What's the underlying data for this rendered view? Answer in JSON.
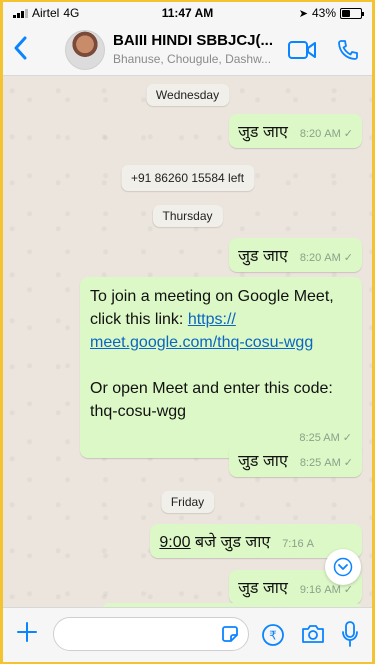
{
  "status_bar": {
    "carrier": "Airtel",
    "network": "4G",
    "time": "11:47 AM",
    "battery": "43%",
    "battery_level": 0.43
  },
  "header": {
    "title": "BAIII HINDI SBBJCJ(...",
    "subtitle": "Bhanuse, Chougule, Dashw..."
  },
  "chat": {
    "day1": "Wednesday",
    "msg1": {
      "text": "जुड जाए",
      "time": "8:20 AM"
    },
    "system_note": "+91 86260 15584 left",
    "day2": "Thursday",
    "msg2": {
      "text": "जुड जाए",
      "time": "8:20 AM"
    },
    "msg3": {
      "line1": "To join a meeting on Google Meet,",
      "line2": "click this link:",
      "link_part1": "https://",
      "link_part2": "meet.google.com/thq-cosu-wgg",
      "line3": "Or open Meet and enter this code:",
      "code": "thq-cosu-wgg",
      "time": "8:25 AM"
    },
    "msg4": {
      "text": "जुड जाए",
      "time": "8:25 AM"
    },
    "day3": "Friday",
    "msg5": {
      "time_word": "9:00",
      "text": " बजे जुड जाए",
      "time": "7:16 A"
    },
    "msg6": {
      "text": "जुड जाए",
      "time": "9:16 AM"
    }
  },
  "colors": {
    "accent": "#0a84ff",
    "outgoing_bubble": "#dcf8c6",
    "chat_bg": "#ece5dd"
  },
  "icons": [
    "back-chevron-icon",
    "video-call-icon",
    "phone-icon",
    "scroll-down-icon",
    "plus-icon",
    "sticker-icon",
    "rupee-icon",
    "camera-icon",
    "mic-icon"
  ]
}
